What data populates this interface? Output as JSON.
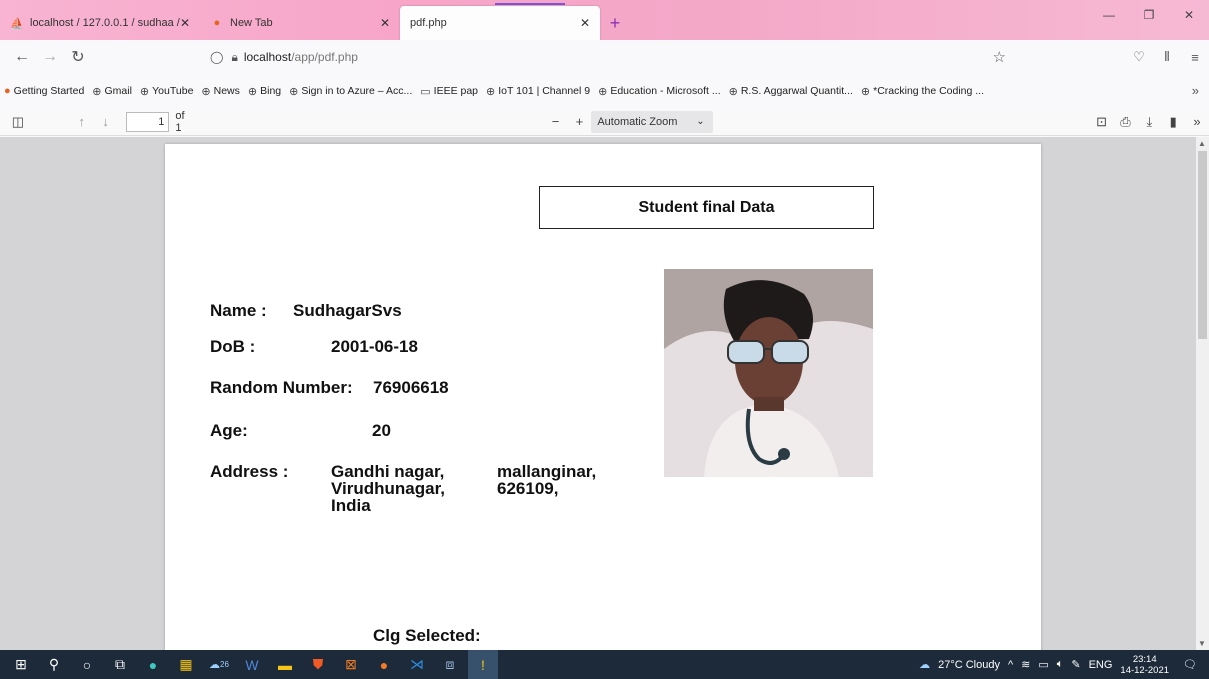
{
  "browser": {
    "tabs": [
      {
        "label": "localhost / 127.0.0.1 / sudhaa / ",
        "icon": "phpmyadmin-icon"
      },
      {
        "label": "New Tab",
        "icon": "firefox-icon"
      },
      {
        "label": "pdf.php",
        "icon": ""
      }
    ],
    "url_host": "localhost",
    "url_path": "/app/pdf.php",
    "bookmarks": [
      "Getting Started",
      "Gmail",
      "YouTube",
      "News",
      "Bing",
      "Sign in to Azure – Acc...",
      "IEEE pap",
      "IoT 101 | Channel 9",
      "Education - Microsoft ...",
      "R.S. Aggarwal Quantit...",
      "*Cracking the Coding ..."
    ]
  },
  "pdf_toolbar": {
    "page_number": "1",
    "page_total": "of 1",
    "zoom": "Automatic Zoom"
  },
  "document": {
    "title": "Student final Data",
    "name_label": "Name :",
    "name_value": "SudhagarSvs",
    "dob_label": "DoB :",
    "dob_value": "2001-06-18",
    "random_label": "Random Number:",
    "random_value": "76906618",
    "age_label": "Age:",
    "age_value": "20",
    "address_label": "Address :",
    "address_col1_line1": "Gandhi nagar,",
    "address_col1_line2": "Virudhunagar,",
    "address_col1_line3": "India",
    "address_col2_line1": "mallanginar,",
    "address_col2_line2": "626109,",
    "clg_label": "Clg Selected:"
  },
  "taskbar": {
    "badge": "26",
    "weather": "27°C  Cloudy",
    "lang": "ENG",
    "time": "23:14",
    "date": "14-12-2021"
  }
}
